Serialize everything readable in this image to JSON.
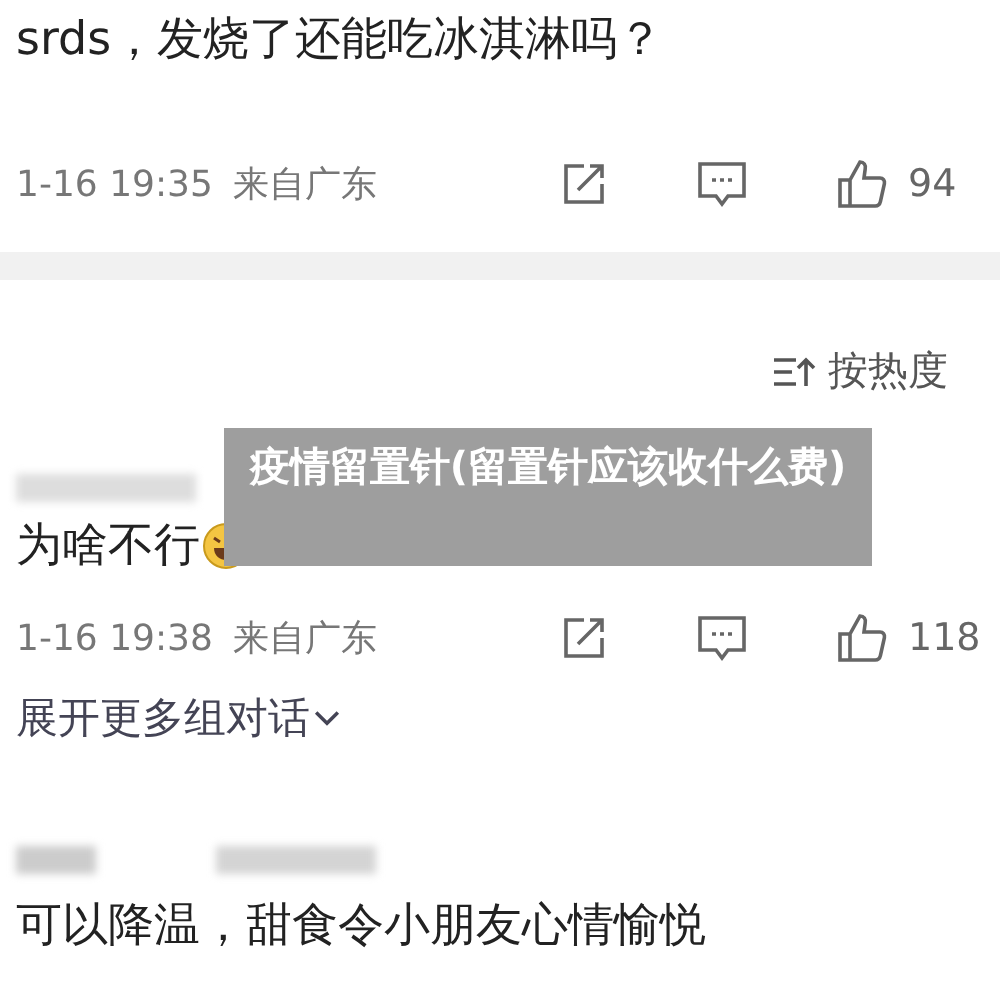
{
  "comments": [
    {
      "text": "srds，发烧了还能吃冰淇淋吗？",
      "date": "1-16 19:35",
      "location": "来自广东",
      "likes": "94"
    }
  ],
  "sort": {
    "label": "按热度"
  },
  "thread": [
    {
      "text": "为啥不行",
      "emoji": true,
      "date": "1-16 19:38",
      "location": "来自广东",
      "likes": "118"
    }
  ],
  "expand_link": "展开更多组对话",
  "next_comment": {
    "text": "可以降温，甜食令小朋友心情愉悦"
  },
  "banner": {
    "title": "疫情留置针(留置针应该收什么费)"
  }
}
